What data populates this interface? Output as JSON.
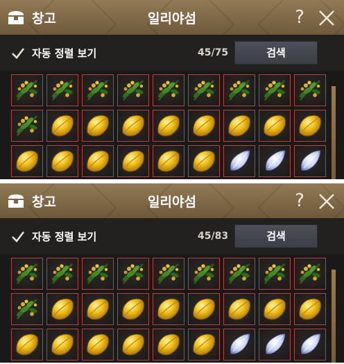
{
  "panels": [
    {
      "title_left": "창고",
      "title_center": "일리야섬",
      "help_label": "?",
      "sort_label": "자동 정렬 보기",
      "count": "45/75",
      "search_label": "검색",
      "rows": [
        [
          "herb",
          "herb",
          "herb",
          "herb",
          "herb",
          "herb",
          "herb",
          "herb",
          "herb"
        ],
        [
          "herb",
          "gold",
          "gold",
          "gold",
          "gold",
          "gold",
          "gold",
          "gold",
          "gold"
        ],
        [
          "gold",
          "gold",
          "gold",
          "gold",
          "gold",
          "gold",
          "crystal",
          "crystal",
          "crystal"
        ]
      ]
    },
    {
      "title_left": "창고",
      "title_center": "일리야섬",
      "help_label": "?",
      "sort_label": "자동 정렬 보기",
      "count": "45/83",
      "search_label": "검색",
      "rows": [
        [
          "herb",
          "herb",
          "herb",
          "herb",
          "herb",
          "herb",
          "herb",
          "herb",
          "herb"
        ],
        [
          "herb",
          "gold",
          "gold",
          "gold",
          "gold",
          "gold",
          "gold",
          "gold",
          "gold"
        ],
        [
          "gold",
          "gold",
          "gold",
          "gold",
          "gold",
          "gold",
          "crystal",
          "crystal",
          "crystal"
        ]
      ]
    }
  ],
  "colors": {
    "header": "#7c6644",
    "slot_border": "#b2473d",
    "search_button": "#44464e"
  },
  "icons": {
    "herb": "herb-item-icon",
    "gold": "gold-leaf-item-icon",
    "crystal": "crystal-item-icon"
  }
}
